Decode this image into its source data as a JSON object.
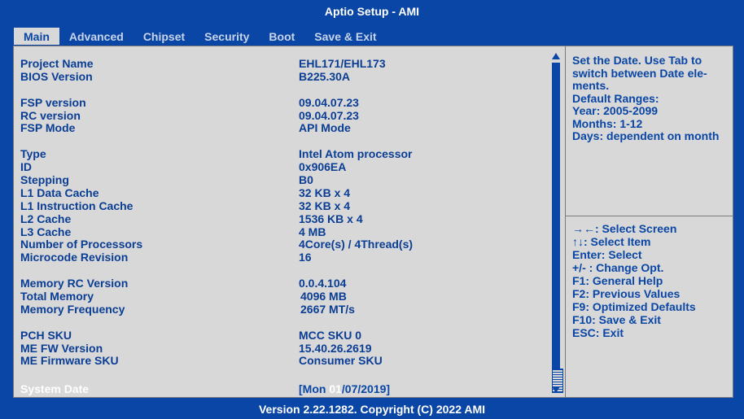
{
  "title": "Aptio Setup - AMI",
  "tabs": [
    {
      "label": "Main"
    },
    {
      "label": "Advanced"
    },
    {
      "label": "Chipset"
    },
    {
      "label": "Security"
    },
    {
      "label": "Boot"
    },
    {
      "label": "Save & Exit"
    }
  ],
  "info": [
    {
      "label": "Project Name",
      "value": "EHL171/EHL173"
    },
    {
      "label": "BIOS Version",
      "value": "B225.30A"
    },
    {
      "label": "FSP version",
      "value": "09.04.07.23"
    },
    {
      "label": "RC version",
      "value": "09.04.07.23"
    },
    {
      "label": "FSP Mode",
      "value": "API Mode"
    },
    {
      "label": "Type",
      "value": "Intel Atom processor"
    },
    {
      "label": "ID",
      "value": "0x906EA"
    },
    {
      "label": "Stepping",
      "value": "B0"
    },
    {
      "label": "L1 Data Cache",
      "value": "32 KB x 4"
    },
    {
      "label": "L1 Instruction Cache",
      "value": "32 KB x 4"
    },
    {
      "label": "L2 Cache",
      "value": "1536 KB x 4"
    },
    {
      "label": "L3 Cache",
      "value": "4 MB"
    },
    {
      "label": "Number of Processors",
      "value": "4Core(s) / 4Thread(s)"
    },
    {
      "label": "Microcode Revision",
      "value": "16"
    },
    {
      "label": "Memory RC Version",
      "value": "0.0.4.104"
    },
    {
      "label": "Total Memory",
      "value": "4096 MB"
    },
    {
      "label": "Memory Frequency",
      "value": "2667 MT/s"
    },
    {
      "label": "PCH SKU",
      "value": "MCC SKU 0"
    },
    {
      "label": "ME FW Version",
      "value": "15.40.26.2619"
    },
    {
      "label": "ME Firmware SKU",
      "value": "Consumer SKU"
    }
  ],
  "system_date": {
    "label": "System Date",
    "value_prefix": "[Mon ",
    "value_highlight": "01",
    "value_suffix": "/07/2019]"
  },
  "help": {
    "lines": [
      "Set the Date. Use Tab to switch between Date ele-ments.",
      "Default Ranges:",
      "Year: 2005-2099",
      "Months: 1-12",
      "Days: dependent on month"
    ]
  },
  "keys": [
    "→←: Select Screen",
    "↑↓: Select Item",
    "Enter: Select",
    "+/- : Change Opt.",
    "F1: General Help",
    "F2: Previous Values",
    "F9: Optimized Defaults",
    "F10: Save & Exit",
    "ESC: Exit"
  ],
  "footer": "Version 2.22.1282. Copyright (C) 2022 AMI",
  "colors": {
    "background": "#0a46a5",
    "panel": "#d8d8d8",
    "text_dark": "#0a3d94",
    "text_light": "#ffffff"
  },
  "scrollbar": {
    "position": 0.97
  }
}
